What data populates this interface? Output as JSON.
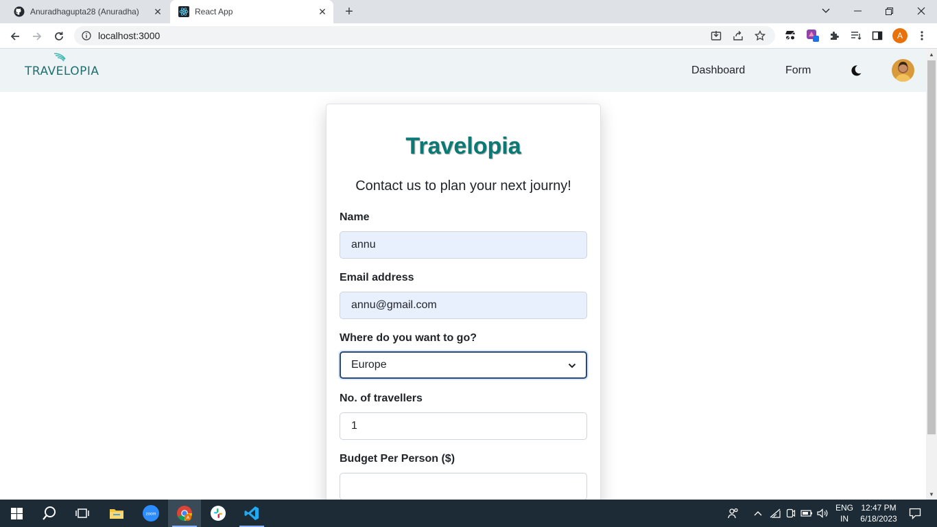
{
  "browser": {
    "tabs": [
      {
        "title": "Anuradhagupta28 (Anuradha)",
        "favicon": "github-icon",
        "active": false
      },
      {
        "title": "React App",
        "favicon": "react-icon",
        "active": true
      }
    ],
    "url": "localhost:3000",
    "profile_initial": "A"
  },
  "navbar": {
    "brand": "TRAVELOPIA",
    "links": [
      "Dashboard",
      "Form"
    ]
  },
  "form": {
    "title": "Travelopia",
    "subtitle": "Contact us to plan your next journy!",
    "name_label": "Name",
    "name_value": "annu",
    "email_label": "Email address",
    "email_value": "annu@gmail.com",
    "destination_label": "Where do you want to go?",
    "destination_value": "Europe",
    "travellers_label": "No. of travellers",
    "travellers_value": "1",
    "budget_label": "Budget Per Person ($)",
    "budget_value": ""
  },
  "taskbar": {
    "language": "ENG",
    "region": "IN",
    "time": "12:47 PM",
    "date": "6/18/2023"
  },
  "colors": {
    "brand_teal": "#0b7a75",
    "navbar_bg": "#eef3f6",
    "autofill_bg": "#e8f0fe",
    "taskbar_bg": "#1c2b36"
  }
}
